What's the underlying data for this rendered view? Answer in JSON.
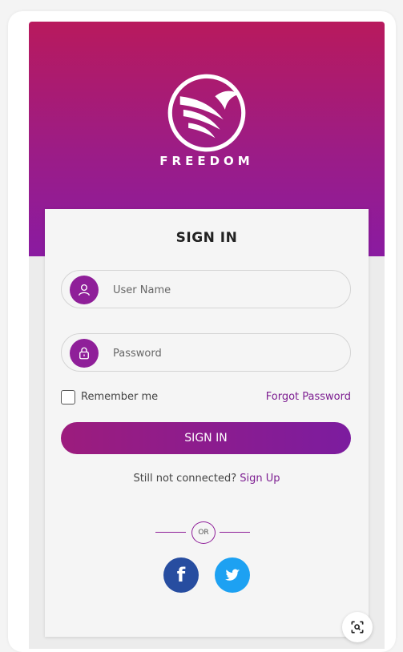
{
  "brand": {
    "name": "FREEDOM",
    "logo_icon": "bird-swoosh-logo"
  },
  "signin": {
    "title": "SIGN IN",
    "username_placeholder": "User Name",
    "password_placeholder": "Password",
    "remember_label": "Remember me",
    "forgot_label": "Forgot Password",
    "button_label": "SIGN IN",
    "still_text": "Still not connected?",
    "signup_link": "Sign Up",
    "or_label": "OR"
  },
  "social": {
    "facebook_glyph": "f",
    "twitter_icon": "twitter-bird-icon"
  },
  "colors": {
    "gradient_top": "#b81a5d",
    "gradient_bottom": "#8a1ba1",
    "accent": "#8f1f99",
    "facebook": "#274da0",
    "twitter": "#1da1f2"
  }
}
